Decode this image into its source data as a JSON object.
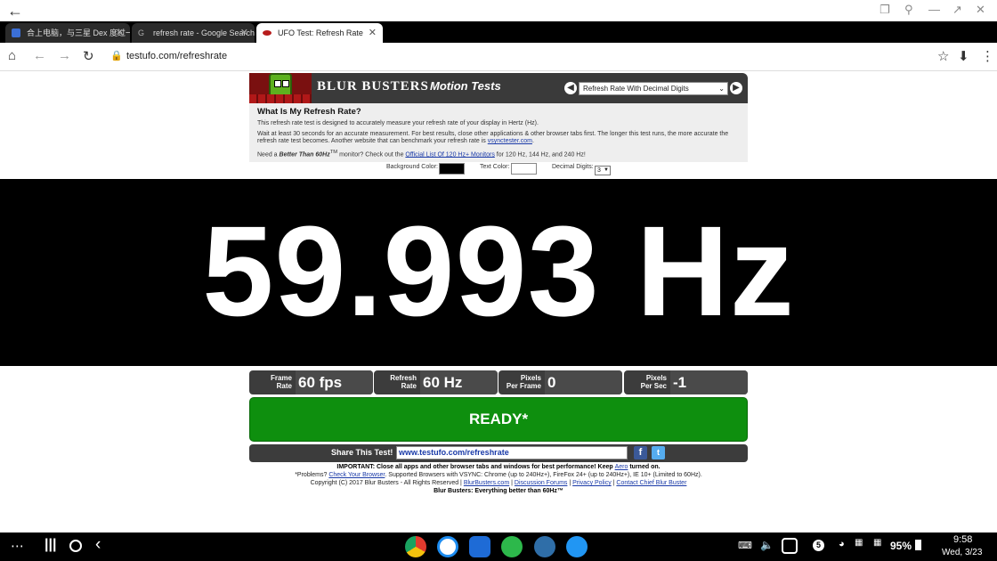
{
  "browser": {
    "tabs": [
      {
        "title": "合上电脑，与三星 Dex 度过一…",
        "favicon_color": "#3b6fd6",
        "active": false
      },
      {
        "title": "refresh rate - Google Search",
        "favicon_color": "#888888",
        "active": false
      },
      {
        "title": "UFO Test: Refresh Rate",
        "favicon_color": "#b71c1c",
        "active": true
      }
    ],
    "new_tab_label": "+",
    "url": "testufo.com/refreshrate"
  },
  "header": {
    "title": "BLUR BUSTERS",
    "subtitle": "Motion Tests",
    "selected_test": "Refresh Rate With Decimal Digits"
  },
  "info": {
    "heading": "What Is My Refresh Rate?",
    "p1": "This refresh rate test is designed to accurately measure your refresh rate of your display in Hertz (Hz).",
    "p2_a": "Wait at least 30 seconds for an accurate measurement. For best results, close other applications & other browser tabs first. The longer this test runs, the more accurate the refresh rate test becomes. Another website that can benchmark your refresh rate is ",
    "p2_link": "vsynctester.com",
    "p2_b": ".",
    "p3_a": "Need a ",
    "p3_em": "Better Than 60Hz",
    "p3_tm": "TM",
    "p3_b": " monitor? Check out the ",
    "p3_link": "Official List Of 120 Hz+ Monitors",
    "p3_c": " for 120 Hz, 144 Hz, and 240 Hz!"
  },
  "options": {
    "bg_label": "Background Color:",
    "bg_color": "#000000",
    "text_label": "Text Color:",
    "text_color": "#ffffff",
    "digits_label": "Decimal Digits:",
    "digits_value": "3"
  },
  "measurement": {
    "value": "59.993 Hz"
  },
  "stats": [
    {
      "label": "Frame\nRate",
      "value": "60 fps"
    },
    {
      "label": "Refresh\nRate",
      "value": "60 Hz"
    },
    {
      "label": "Pixels\nPer Frame",
      "value": "0"
    },
    {
      "label": "Pixels\nPer Sec",
      "value": "-1"
    }
  ],
  "ready_label": "READY*",
  "share": {
    "label": "Share This Test!",
    "url": "www.testufo.com/refreshrate"
  },
  "footer": {
    "important_a": "IMPORTANT: Close all apps and other browser tabs and windows for best performance! Keep ",
    "important_link": "Aero",
    "important_b": " turned on.",
    "problems_a": "*Problems? ",
    "problems_link": "Check Your Browser",
    "problems_b": ". Supported Browsers with VSYNC: Chrome (up to 240Hz+), FireFox 24+ (up to 240Hz+), IE 10+ (Limited to 60Hz).",
    "copyright": "Copyright (C) 2017 Blur Busters - All Rights Reserved | ",
    "link1": "BlurBusters.com",
    "sep1": " | ",
    "link2": "Discussion Forums",
    "sep2": " | ",
    "link3": "Privacy Policy",
    "sep3": " | ",
    "link4": "Contact Chief Blur Buster",
    "tagline": "Blur Busters: Everything better than 60Hz™"
  },
  "system": {
    "notif_count": "5",
    "battery": "95%",
    "time": "9:58",
    "date": "Wed, 3/23"
  },
  "dock": [
    {
      "name": "chrome-app",
      "color": "#e8b21a"
    },
    {
      "name": "bird-app",
      "color": "#1d8cf0"
    },
    {
      "name": "star-app",
      "color": "#1e6bd6"
    },
    {
      "name": "wechat-app",
      "color": "#2db84b"
    },
    {
      "name": "penguin-app",
      "color": "#2f6ea8"
    },
    {
      "name": "send-app",
      "color": "#2196f3"
    }
  ]
}
